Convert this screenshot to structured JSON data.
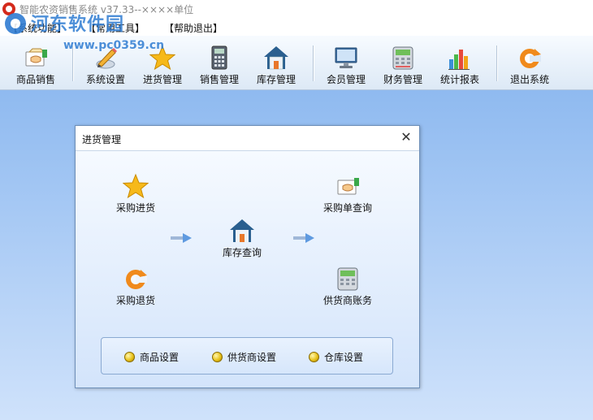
{
  "window": {
    "title": "智能农资销售系统 v37.33--××××单位"
  },
  "watermark": {
    "site_name": "河东软件园",
    "url": "www.pc0359.cn"
  },
  "menu": {
    "items": [
      {
        "label": "【系统功能】"
      },
      {
        "label": "【常用工具】"
      },
      {
        "label": "【帮助退出】"
      }
    ]
  },
  "toolbar": {
    "items": [
      {
        "label": "商品销售",
        "icon": "handshake-icon"
      },
      {
        "label": "系统设置",
        "icon": "pencil-icon"
      },
      {
        "label": "进货管理",
        "icon": "star-icon"
      },
      {
        "label": "销售管理",
        "icon": "calculator-icon"
      },
      {
        "label": "库存管理",
        "icon": "house-icon"
      },
      {
        "label": "会员管理",
        "icon": "monitor-icon"
      },
      {
        "label": "财务管理",
        "icon": "cash-register-icon"
      },
      {
        "label": "统计报表",
        "icon": "bar-chart-icon"
      },
      {
        "label": "退出系统",
        "icon": "exit-refresh-icon"
      }
    ]
  },
  "dialog": {
    "title": "进货管理",
    "close": "✕",
    "functions": {
      "purchase_in": "采购进货",
      "purchase_order_query": "采购单查询",
      "stock_query": "库存查询",
      "purchase_return": "采购退货",
      "supplier_account": "供货商账务"
    },
    "settings": [
      {
        "label": "商品设置"
      },
      {
        "label": "供货商设置"
      },
      {
        "label": "仓库设置"
      }
    ]
  }
}
